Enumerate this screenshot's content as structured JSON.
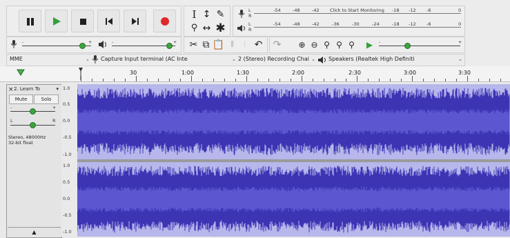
{
  "transport": {
    "buttons": [
      {
        "name": "pause-button",
        "icon": "pause-icon"
      },
      {
        "name": "play-button",
        "icon": "play-icon"
      },
      {
        "name": "stop-button",
        "icon": "stop-icon"
      },
      {
        "name": "skip-to-start-button",
        "icon": "skip-start-icon"
      },
      {
        "name": "skip-to-end-button",
        "icon": "skip-end-icon"
      },
      {
        "name": "record-button",
        "icon": "record-icon"
      }
    ]
  },
  "meters": {
    "record_ticks": [
      "-54",
      "-48",
      "-42",
      "Click to Start Monitoring",
      "-18",
      "-12",
      "-6",
      "0"
    ],
    "playback_ticks": [
      "-54",
      "-48",
      "-42",
      "-36",
      "-30",
      "-24",
      "-18",
      "-12",
      "-6",
      "0"
    ],
    "record_channel_labels": [
      "L",
      "R"
    ],
    "playback_channel_labels": [
      "L",
      "R"
    ]
  },
  "mixer": {
    "record_min": "-",
    "record_max": "+",
    "record_level": 0.87,
    "playback_min": "-",
    "playback_max": "+",
    "playback_level": 0.9,
    "play_at_speed_min": "-",
    "play_at_speed_max": "+",
    "play_at_speed_level": 0.35
  },
  "devices": {
    "host": "MME",
    "recording_device": "Capture Input terminal (AC Inte",
    "channels": "2 (Stereo) Recording Chai",
    "playback_device": "Speakers (Realtek High Definiti"
  },
  "timeline": {
    "ticks": [
      "0",
      "30",
      "1:00",
      "1:30",
      "2:00",
      "2:30",
      "3:00",
      "3:30"
    ]
  },
  "track": {
    "name": "2. Learn To",
    "mute_label": "Mute",
    "solo_label": "Solo",
    "gain_min": "-",
    "gain_max": "+",
    "pan_left": "L",
    "pan_right": "R",
    "info_line1": "Stereo, 48000Hz",
    "info_line2": "32-bit float",
    "collapse_icon": "up-arrow-icon",
    "close_icon": "close-icon",
    "menu_icon": "chevron-down-icon"
  },
  "scale": {
    "top_channel": [
      "1.0",
      "0.5",
      "0.0",
      "-0.5",
      "-1.0"
    ],
    "bottom_channel": [
      "1.0",
      "0.5",
      "0.0",
      "-0.5",
      "-1.0"
    ]
  },
  "colors": {
    "waveform": "#3d34b4",
    "waveform_rms": "#5c57d1",
    "waveform_bg": "#b7b7ec",
    "play": "#34a03a",
    "record": "#e0282c"
  }
}
